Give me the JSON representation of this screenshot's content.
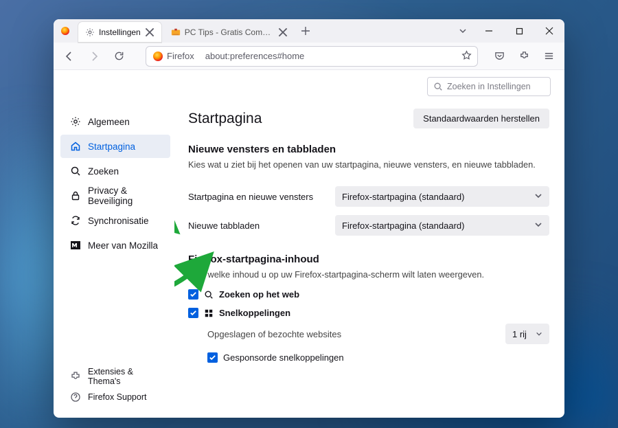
{
  "window": {
    "tabs": [
      {
        "label": "Instellingen",
        "icon": "gear"
      },
      {
        "label": "PC Tips - Gratis Computer Tips…",
        "icon": "pctips"
      }
    ]
  },
  "toolbar": {
    "identity_label": "Firefox",
    "url": "about:preferences#home"
  },
  "prefs_search": {
    "placeholder": "Zoeken in Instellingen"
  },
  "sidebar": {
    "items": [
      {
        "label": "Algemeen",
        "icon": "gear"
      },
      {
        "label": "Startpagina",
        "icon": "home"
      },
      {
        "label": "Zoeken",
        "icon": "search"
      },
      {
        "label": "Privacy & Beveiliging",
        "icon": "lock"
      },
      {
        "label": "Synchronisatie",
        "icon": "sync"
      },
      {
        "label": "Meer van Mozilla",
        "icon": "mozilla"
      }
    ],
    "footer": [
      {
        "label": "Extensies & Thema's",
        "icon": "puzzle"
      },
      {
        "label": "Firefox Support",
        "icon": "help"
      }
    ]
  },
  "page": {
    "title": "Startpagina",
    "restore_btn": "Standaardwaarden herstellen",
    "section1_title": "Nieuwe vensters en tabbladen",
    "section1_desc": "Kies wat u ziet bij het openen van uw startpagina, nieuwe vensters, en nieuwe tabbladen.",
    "row1_label": "Startpagina en nieuwe vensters",
    "row1_value": "Firefox-startpagina (standaard)",
    "row2_label": "Nieuwe tabbladen",
    "row2_value": "Firefox-startpagina (standaard)",
    "section2_title": "Firefox-startpagina-inhoud",
    "section2_desc": "Kies welke inhoud u op uw Firefox-startpagina-scherm wilt laten weergeven.",
    "chk_websearch": "Zoeken op het web",
    "chk_shortcuts": "Snelkoppelingen",
    "shortcuts_sub": "Opgeslagen of bezochte websites",
    "shortcuts_rows_value": "1 rij",
    "chk_sponsored": "Gesponsorde snelkoppelingen"
  }
}
